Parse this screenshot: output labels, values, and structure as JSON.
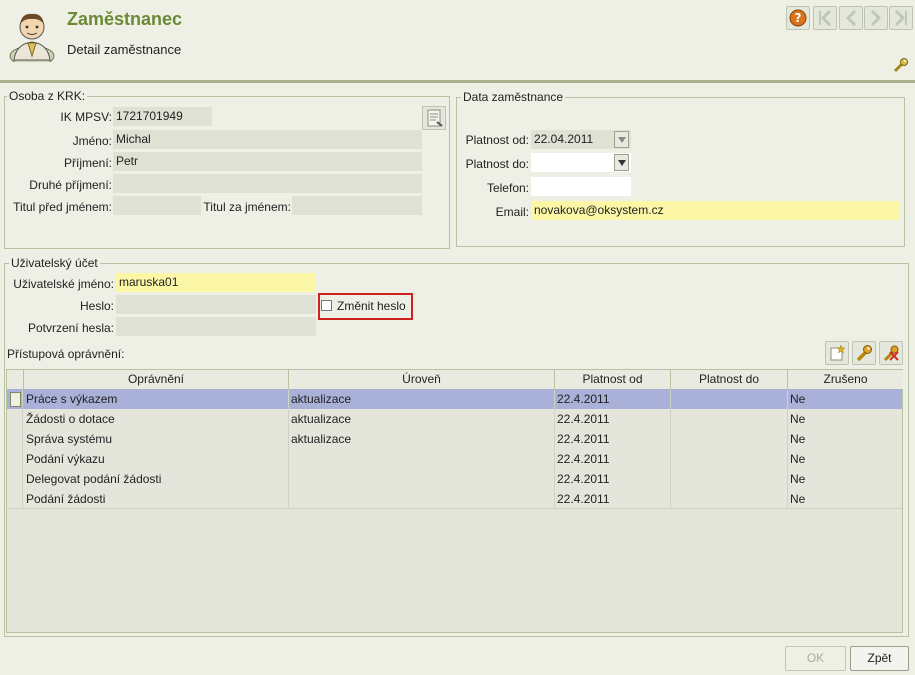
{
  "header": {
    "title": "Zaměstnanec",
    "subtitle": "Detail zaměstnance",
    "avatar_icon": "user-avatar-icon",
    "nav": [
      "help-icon",
      "first-icon",
      "prev-icon",
      "next-icon",
      "last-icon"
    ]
  },
  "krk": {
    "legend": "Osoba z KRK:",
    "ik_label": "IK MPSV:",
    "ik_value": "1721701949",
    "jmeno_label": "Jméno:",
    "jmeno_value": "Michal",
    "prijmeni_label": "Příjmení:",
    "prijmeni_value": "Petr",
    "druhe_label": "Druhé příjmení:",
    "druhe_value": "",
    "titul_pred_label": "Titul před jménem:",
    "titul_pred_value": "",
    "titul_za_label": "Titul za jménem:",
    "titul_za_value": ""
  },
  "employee": {
    "legend": "Data zaměstnance",
    "platnost_od_label": "Platnost od:",
    "platnost_od_value": "22.04.2011",
    "platnost_do_label": "Platnost do:",
    "platnost_do_value": "",
    "telefon_label": "Telefon:",
    "telefon_value": "",
    "email_label": "Email:",
    "email_value": "novakova@oksystem.cz"
  },
  "account": {
    "legend": "Uživatelský účet",
    "username_label": "Uživatelské jméno:",
    "username_value": "maruska01",
    "password_label": "Heslo:",
    "password_value": "",
    "confirm_label": "Potvrzení hesla:",
    "confirm_value": "",
    "change_password_label": "Změnit heslo",
    "change_password_checked": false,
    "permissions_label": "Přístupová oprávnění:"
  },
  "table": {
    "columns": [
      "Oprávnění",
      "Úroveň",
      "Platnost od",
      "Platnost do",
      "Zrušeno"
    ],
    "rows": [
      {
        "opravneni": "Práce s výkazem",
        "uroven": "aktualizace",
        "od": "22.4.2011",
        "do": "",
        "zruseno": "Ne"
      },
      {
        "opravneni": "Žádosti o dotace",
        "uroven": "aktualizace",
        "od": "22.4.2011",
        "do": "",
        "zruseno": "Ne"
      },
      {
        "opravneni": "Správa systému",
        "uroven": "aktualizace",
        "od": "22.4.2011",
        "do": "",
        "zruseno": "Ne"
      },
      {
        "opravneni": "Podání výkazu",
        "uroven": "",
        "od": "22.4.2011",
        "do": "",
        "zruseno": "Ne"
      },
      {
        "opravneni": "Delegovat podání žádosti",
        "uroven": "",
        "od": "22.4.2011",
        "do": "",
        "zruseno": "Ne"
      },
      {
        "opravneni": "Podání žádosti",
        "uroven": "",
        "od": "22.4.2011",
        "do": "",
        "zruseno": "Ne"
      }
    ]
  },
  "footer": {
    "ok_label": "OK",
    "back_label": "Zpět"
  },
  "colors": {
    "title_green": "#6b8a36",
    "highlight_yellow": "#fbf7a6",
    "selected_row": "#aab1d8",
    "red_box": "#cc2222"
  }
}
